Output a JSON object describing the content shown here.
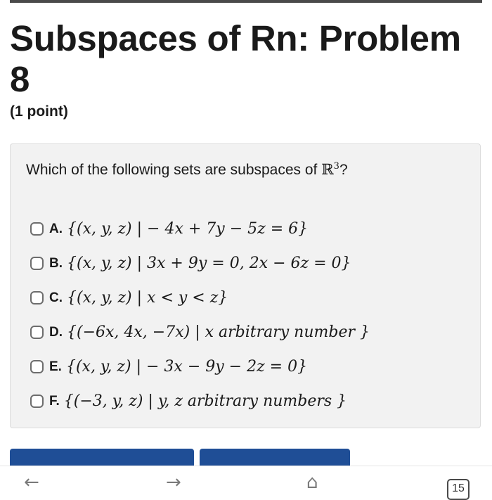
{
  "header": {
    "title": "Subspaces of Rn: Problem 8",
    "points": "(1 point)"
  },
  "question": {
    "text": "Which of the following sets are subspaces of ",
    "space": "ℝ",
    "exponent": "3",
    "suffix": "?"
  },
  "options": [
    {
      "label": "A.",
      "math": "{(x, y, z) | − 4x + 7y − 5z = 6}"
    },
    {
      "label": "B.",
      "math": "{(x, y, z) | 3x + 9y = 0, 2x − 6z = 0}"
    },
    {
      "label": "C.",
      "math": "{(x, y, z) | x < y < z}"
    },
    {
      "label": "D.",
      "math": "{(−6x, 4x, −7x) | x arbitrary number }"
    },
    {
      "label": "E.",
      "math": "{(x, y, z) | − 3x − 9y − 2z = 0}"
    },
    {
      "label": "F.",
      "math": "{(−3, y, z) | y, z arbitrary numbers }"
    }
  ],
  "browser_nav": {
    "back_icon": "←",
    "forward_icon": "→",
    "home_icon": "⌂",
    "tab_count": "15"
  }
}
